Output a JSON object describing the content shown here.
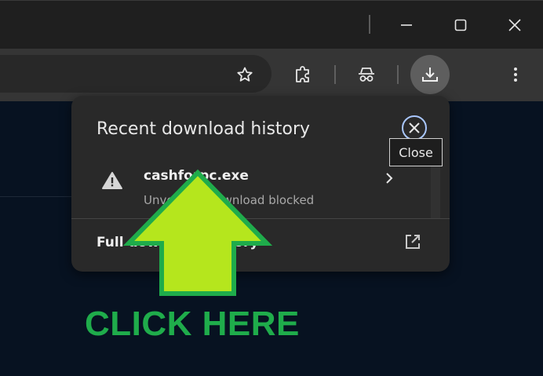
{
  "window": {
    "minimize_icon": "minimize-icon",
    "maximize_icon": "maximize-icon",
    "close_icon": "close-icon"
  },
  "toolbar": {
    "icons": [
      "star-icon",
      "extensions-puzzle-icon",
      "incognito-icon",
      "download-icon",
      "more-vert-icon"
    ]
  },
  "download_panel": {
    "title": "Recent download history",
    "close_tooltip": "Close",
    "items": [
      {
        "file_name": "cashforpc.exe",
        "status": "Unverified download blocked",
        "icon": "warning-icon"
      }
    ],
    "footer_label": "Full download history"
  },
  "overlay": {
    "cta": "CLICK HERE",
    "arrow_color": "#b5e61d",
    "arrow_outline": "#1fac4b"
  },
  "colors": {
    "page_bg": "#071221",
    "titlebar": "#1f1f1f",
    "toolbar": "#353535",
    "panel": "#292929",
    "cta_green": "#1fac4b"
  }
}
